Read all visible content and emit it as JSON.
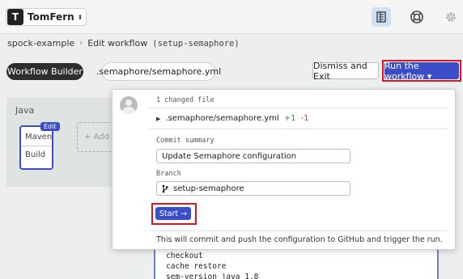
{
  "topbar": {
    "org_initial": "T",
    "org_name": "TomFern",
    "org_caret": "⬍",
    "icons": [
      "docs-icon",
      "help-icon",
      "settings-icon"
    ]
  },
  "breadcrumb": {
    "project": "spock-example",
    "separator": "›",
    "page": "Edit workflow",
    "branch": "(setup-semaphore)"
  },
  "toolbar": {
    "workflow_builder": "Workflow Builder",
    "file_tab": ".semaphore/semaphore.yml",
    "dismiss": "Dismiss and Exit",
    "run": "Run the workflow ▾"
  },
  "canvas": {
    "block_title": "Java",
    "edit_badge": "Edit",
    "block_name": "Maven",
    "job_name": "Build",
    "add_block": "+ Add B"
  },
  "popover": {
    "changed_files": "1 changed file",
    "file_name": ".semaphore/semaphore.yml",
    "additions": "+1",
    "deletions": "-1",
    "commit_label": "Commit summary",
    "commit_value": "Update Semaphore configuration",
    "branch_label": "Branch",
    "branch_value": "setup-semaphore",
    "start": "Start →",
    "note": "This will commit and push the configuration to GitHub and trigger the run."
  },
  "code": {
    "lines": [
      "checkout",
      "cache restore",
      "sem-version java 1.8"
    ]
  },
  "colors": {
    "accent": "#3b4ec8",
    "highlight": "#e0141e",
    "added": "#2f9a3c",
    "removed": "#d23b3b"
  }
}
